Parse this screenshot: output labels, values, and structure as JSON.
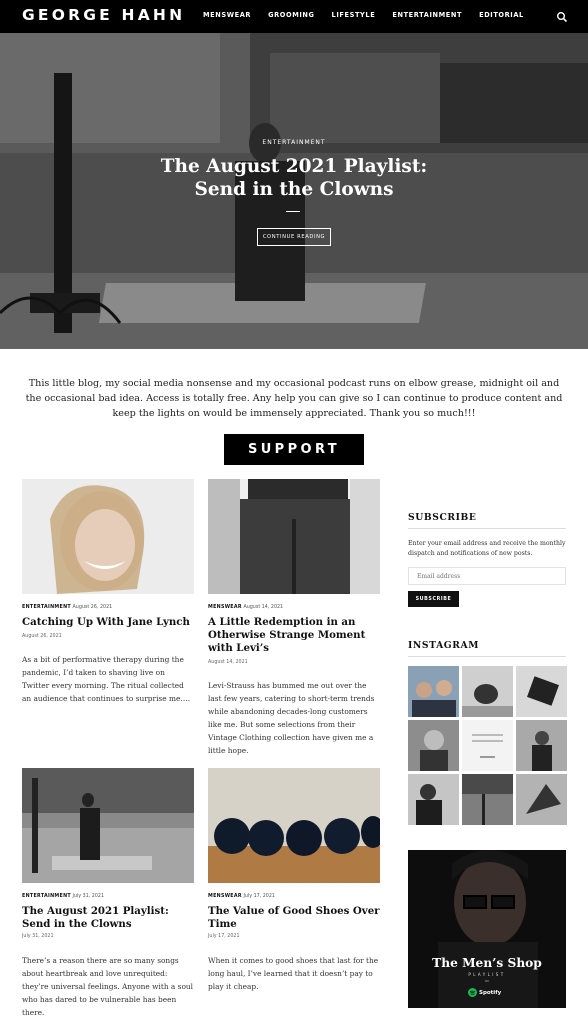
{
  "header": {
    "logo": "GEORGE HAHN",
    "nav": [
      "MENSWEAR",
      "GROOMING",
      "LIFESTYLE",
      "ENTERTAINMENT",
      "EDITORIAL"
    ],
    "search_icon": "search-icon"
  },
  "hero": {
    "category": "ENTERTAINMENT",
    "title": "The August 2021 Playlist:\nSend in the Clowns",
    "button": "CONTINUE READING"
  },
  "appeal": {
    "text": "This little blog, my social media nonsense and my occasional podcast runs on elbow grease, midnight oil and the occasional bad idea. Access is totally free. Any help you can give so I can continue to produce content and keep the lights on would be immensely appreciated. Thank you so much!!!",
    "button": "SUPPORT"
  },
  "posts": [
    {
      "category": "ENTERTAINMENT",
      "date_top": "August 26, 2021",
      "title": "Catching Up With Jane Lynch",
      "date": "August 26, 2021",
      "excerpt": "As a bit of performative therapy during the pandemic, I’d taken to shaving live on Twitter every morning. The ritual collected an audience that continues to surprise me…."
    },
    {
      "category": "MENSWEAR",
      "date_top": "August 14, 2021",
      "title": "A Little Redemption in an Otherwise Strange Moment with Levi’s",
      "date": "August 14, 2021",
      "excerpt": "Levi-Strauss has bummed me out over the last few years, catering to short-term trends while abandoning decades-long customers like me. But some selections from their Vintage Clothing collection have given me a little hope."
    },
    {
      "category": "ENTERTAINMENT",
      "date_top": "July 31, 2021",
      "title": "The August 2021 Playlist: Send in the Clowns",
      "date": "July 31, 2021",
      "excerpt": "There’s a reason there are so many songs about heartbreak and love unrequited: they’re universal feelings. Anyone with a soul who has dared to be vulnerable has been there."
    },
    {
      "category": "MENSWEAR",
      "date_top": "July 17, 2021",
      "title": "The Value of Good Shoes Over Time",
      "date": "July 17, 2021",
      "excerpt": "When it comes to good shoes that last for the long haul, I’ve learned that it doesn’t pay to play it cheap."
    }
  ],
  "sidebar": {
    "subscribe_heading": "SUBSCRIBE",
    "subscribe_text": "Enter your email address and receive the monthly dispatch and notifications of new posts.",
    "email_placeholder": "Email address",
    "subscribe_button": "SUBSCRIBE",
    "instagram_heading": "INSTAGRAM",
    "promo": {
      "title": "The Men’s Shop",
      "subtitle": "PLAYLIST",
      "by": "on",
      "spotify": "Spotify"
    }
  },
  "colors": {
    "header_bg": "#000000",
    "button_bg": "#000000",
    "accent": "#1db954"
  }
}
